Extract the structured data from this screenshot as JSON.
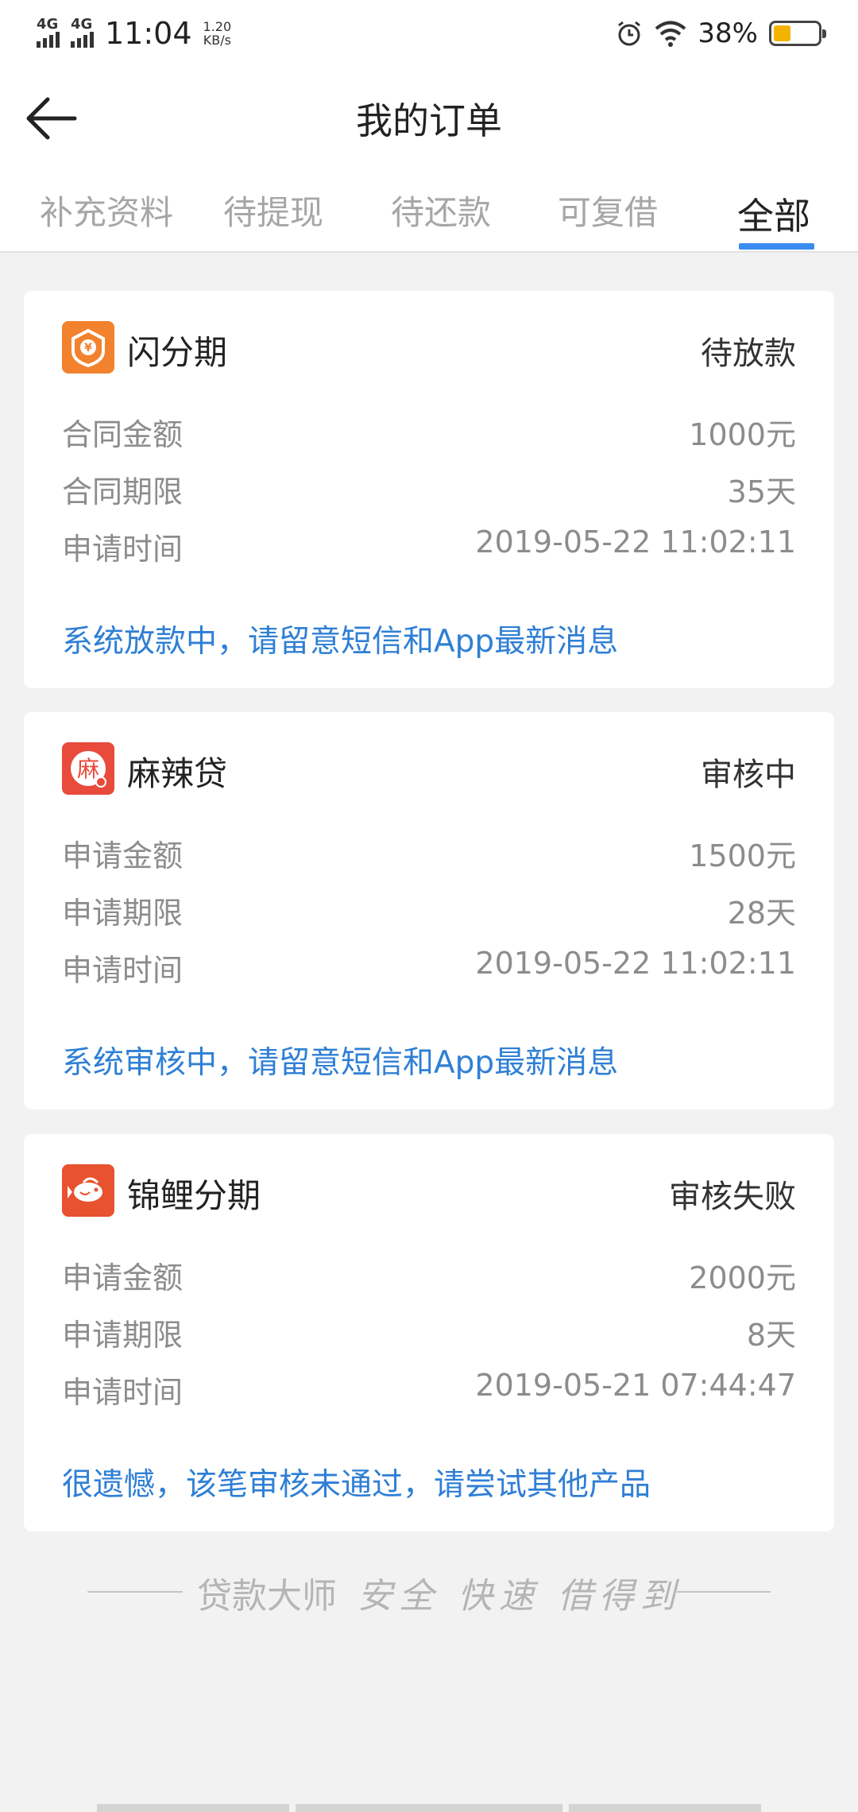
{
  "status_bar": {
    "network_1": "4G",
    "network_2": "4G",
    "time": "11:04",
    "speed_value": "1.20",
    "speed_unit": "KB/s",
    "battery": "38%",
    "battery_level": 0.38,
    "icons": [
      "signal-icon",
      "alarm-icon",
      "wifi-icon",
      "battery-icon"
    ]
  },
  "header": {
    "title": "我的订单",
    "back_icon": "arrow-left-icon"
  },
  "tabs": [
    {
      "label": "补充资料"
    },
    {
      "label": "待提现"
    },
    {
      "label": "待还款"
    },
    {
      "label": "可复借"
    },
    {
      "label": "全部",
      "active": true
    }
  ],
  "orders": [
    {
      "app_name": "闪分期",
      "status": "待放款",
      "icon": "yen-shield-icon",
      "icon_color": "#f2822e",
      "rows": [
        {
          "label": "合同金额",
          "value": "1000元"
        },
        {
          "label": "合同期限",
          "value": "35天"
        },
        {
          "label": "申请时间",
          "value": "2019-05-22 11:02:11"
        }
      ],
      "note": "系统放款中，请留意短信和App最新消息"
    },
    {
      "app_name": "麻辣贷",
      "status": "审核中",
      "icon": "ma-character-icon",
      "icon_glyph": "麻",
      "icon_color": "#e84a3c",
      "rows": [
        {
          "label": "申请金额",
          "value": "1500元"
        },
        {
          "label": "申请期限",
          "value": "28天"
        },
        {
          "label": "申请时间",
          "value": "2019-05-22 11:02:11"
        }
      ],
      "note": "系统审核中，请留意短信和App最新消息"
    },
    {
      "app_name": "锦鲤分期",
      "status": "审核失败",
      "icon": "koi-fish-icon",
      "icon_color": "#e8522f",
      "rows": [
        {
          "label": "申请金额",
          "value": "2000元"
        },
        {
          "label": "申请期限",
          "value": "8天"
        },
        {
          "label": "申请时间",
          "value": "2019-05-21 07:44:47"
        }
      ],
      "note": "很遗憾，该笔审核未通过，请尝试其他产品"
    }
  ],
  "footer": {
    "brand": "贷款大师",
    "slogan": "安全 快速 借得到"
  },
  "colors": {
    "accent": "#3b8cf0",
    "note_text": "#2f7fd5",
    "background": "#f2f2f2"
  }
}
